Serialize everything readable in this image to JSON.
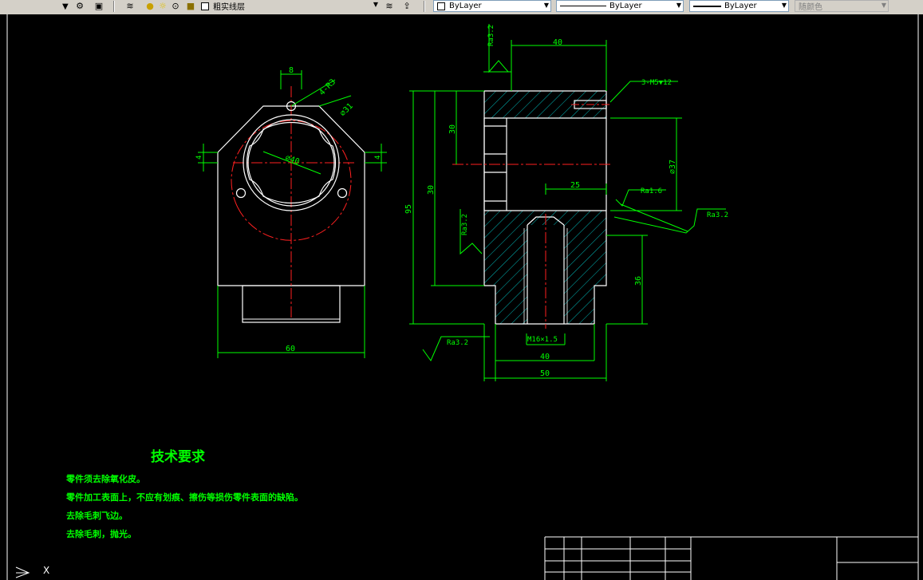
{
  "toolbar": {
    "layer_name": "粗实线层",
    "color_control": "ByLayer",
    "linetype_control": "ByLayer",
    "lineweight_control": "ByLayer",
    "plot_style": "随颜色"
  },
  "views": {
    "front": {
      "dim_top": "8",
      "dim_bolt_hole": "4-R3",
      "dim_outer_dia": "⌀31",
      "dim_inner_dia": "⌀40",
      "dim_side": "4",
      "dim_bottom": "60"
    },
    "section": {
      "dim_top": "40",
      "callout_thread": "3-M5▼12",
      "dim_30a": "30",
      "dim_30b": "30",
      "dim_95": "95",
      "dim_37": "⌀37",
      "dim_25": "25",
      "dim_36": "36",
      "dim_m16": "M16×1.5",
      "dim_40": "40",
      "dim_50": "50",
      "ra_top": "Ra3.2",
      "ra_left": "Ra3.2",
      "ra_16": "Ra1.6",
      "ra_right": "Ra3.2",
      "ra_bottom": "Ra3.2"
    }
  },
  "tech": {
    "title": "技术要求",
    "lines": [
      "零件须去除氧化皮。",
      "零件加工表面上，不应有划痕、擦伤等损伤零件表面的缺陷。",
      "去除毛刺飞边。",
      "去除毛刺，抛光。"
    ]
  },
  "ucs": {
    "label": "X"
  }
}
